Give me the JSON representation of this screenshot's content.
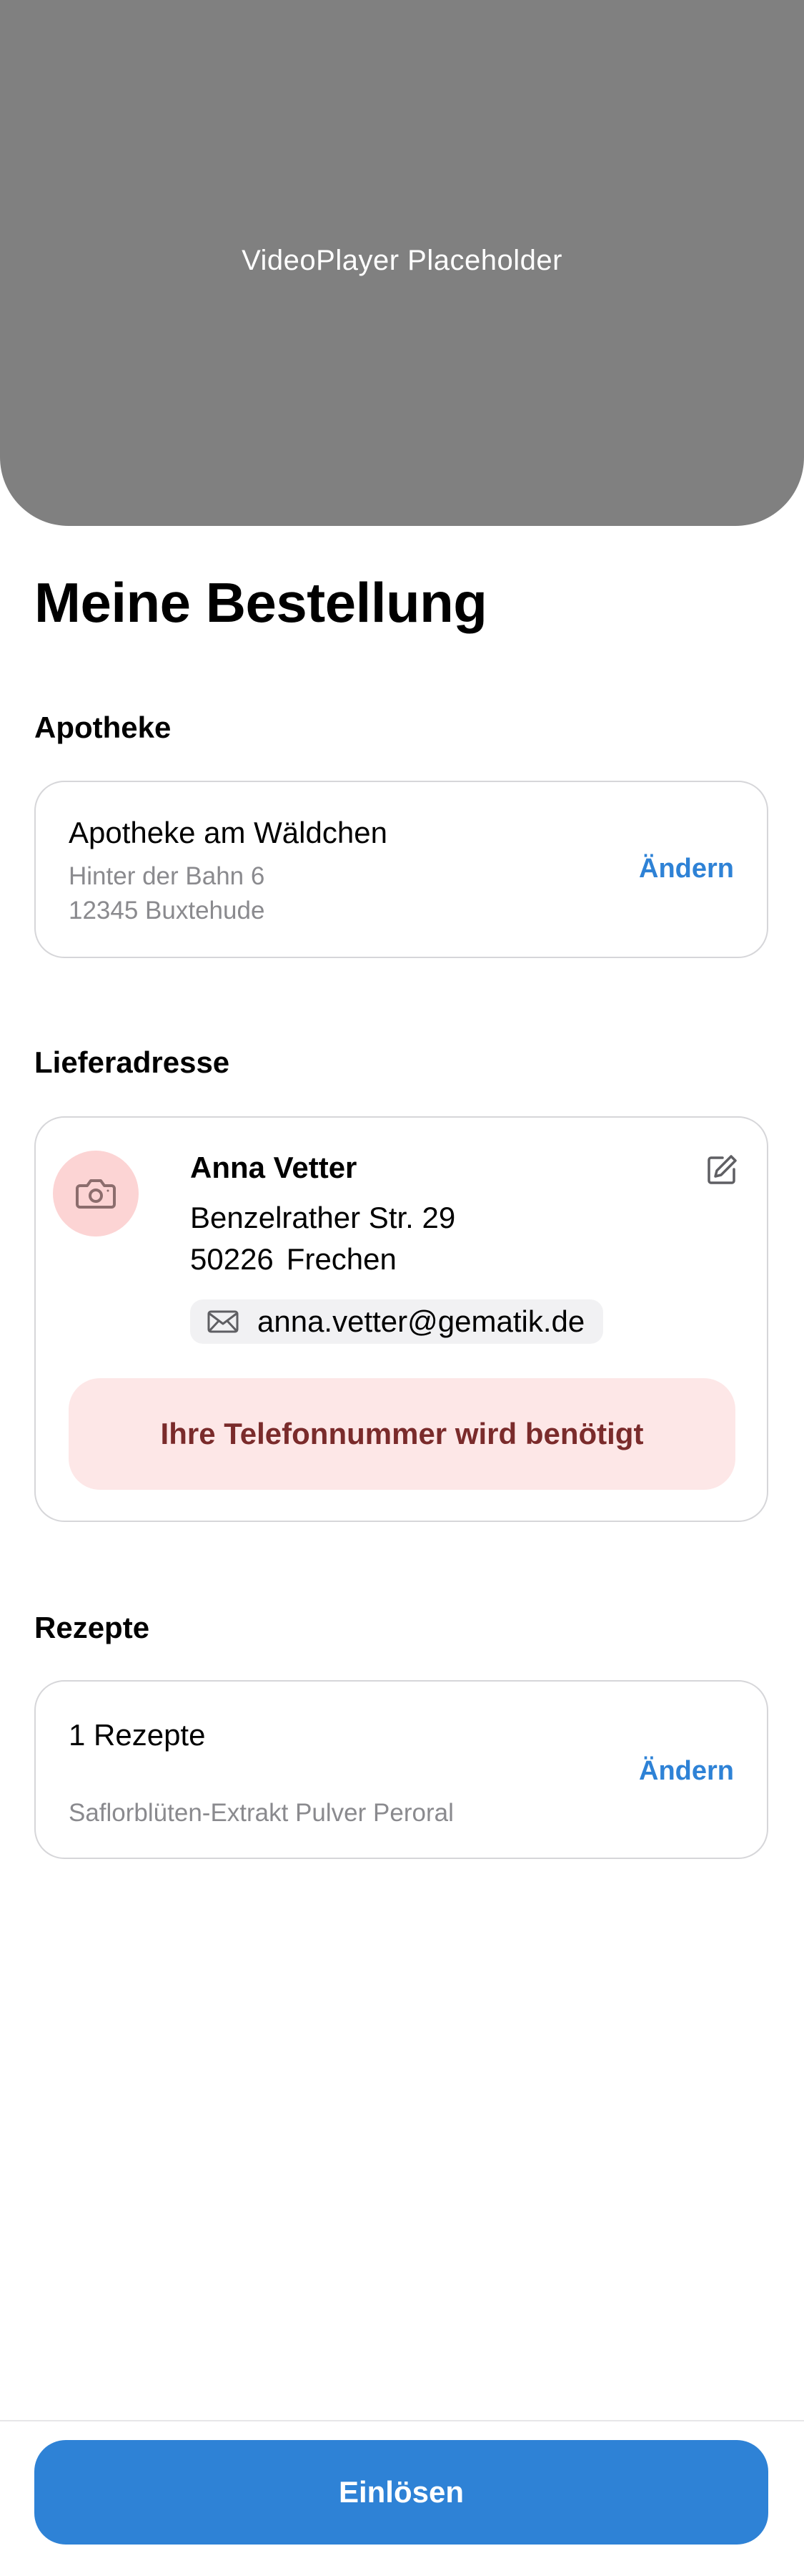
{
  "video": {
    "placeholder_label": "VideoPlayer Placeholder"
  },
  "page": {
    "title": "Meine Bestellung"
  },
  "pharmacy": {
    "section_label": "Apotheke",
    "name": "Apotheke am Wäldchen",
    "street": "Hinter der Bahn 6",
    "city": "12345 Buxtehude",
    "change_label": "Ändern"
  },
  "delivery": {
    "section_label": "Lieferadresse",
    "avatar_icon": "camera-icon",
    "name": "Anna Vetter",
    "street": "Benzelrather Str. 29",
    "zip": "50226",
    "city": "Frechen",
    "email_icon": "mail-icon",
    "email": "anna.vetter@gematik.de",
    "edit_icon": "edit-icon",
    "warning": "Ihre Telefonnummer wird benötigt"
  },
  "prescriptions": {
    "section_label": "Rezepte",
    "count_label": "1 Rezepte",
    "item": "Saflorblüten-Extrakt Pulver Peroral",
    "change_label": "Ändern"
  },
  "footer": {
    "submit_label": "Einlösen"
  },
  "colors": {
    "accent": "#2e82d6",
    "warning_bg": "#fde7e7",
    "warning_text": "#7a2b2b",
    "avatar_bg": "#fcd4d4",
    "video_bg": "#808080"
  }
}
